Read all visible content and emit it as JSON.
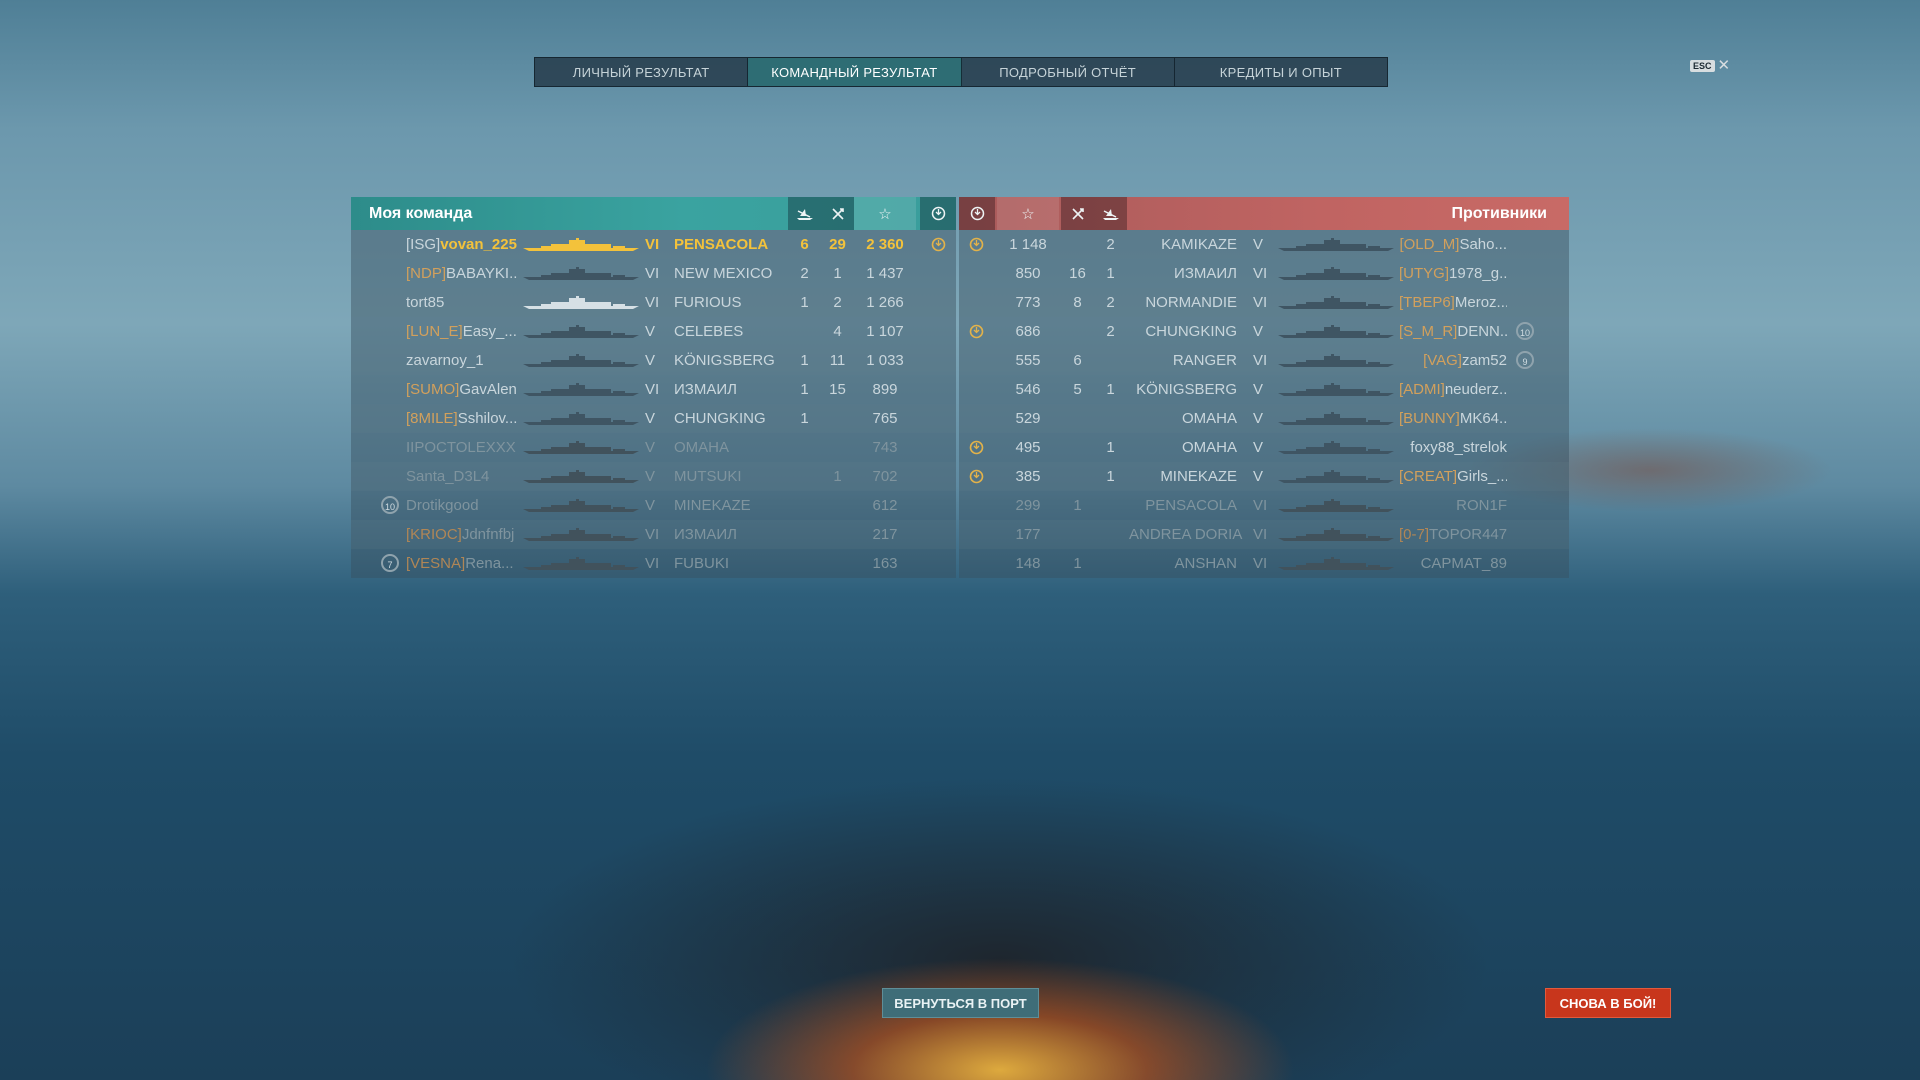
{
  "tabs": [
    "ЛИЧНЫЙ РЕЗУЛЬТАТ",
    "КОМАНДНЫЙ РЕЗУЛЬТАТ",
    "ПОДРОБНЫЙ ОТЧЁТ",
    "КРЕДИТЫ И ОПЫТ"
  ],
  "active_tab": 1,
  "esc": {
    "key": "ESC",
    "close": "✕"
  },
  "left_team": {
    "title": "Моя команда",
    "header_icons": [
      "ship-sunk-icon",
      "planes-shot-icon",
      "experience-star-icon",
      "medal-icon"
    ],
    "players": [
      {
        "clan": "[ISG]",
        "name": "vovan_225",
        "tier": "VI",
        "ship": "PENSACOLA",
        "kills": "6",
        "planes": "29",
        "xp": "2 360",
        "medal": true,
        "me": true,
        "dead": false,
        "badge": ""
      },
      {
        "clan": "[NDP]",
        "name": "BABAYKI...",
        "tier": "VI",
        "ship": "NEW MEXICO",
        "kills": "2",
        "planes": "1",
        "xp": "1 437",
        "medal": false,
        "me": false,
        "dead": false,
        "badge": ""
      },
      {
        "clan": "",
        "name": "tort85",
        "tier": "VI",
        "ship": "FURIOUS",
        "kills": "1",
        "planes": "2",
        "xp": "1 266",
        "medal": false,
        "me": false,
        "dead": false,
        "badge": ""
      },
      {
        "clan": "[LUN_E]",
        "name": "Easy_...",
        "tier": "V",
        "ship": "CELEBES",
        "kills": "",
        "planes": "4",
        "xp": "1 107",
        "medal": false,
        "me": false,
        "dead": false,
        "badge": ""
      },
      {
        "clan": "",
        "name": "zavarnoy_1",
        "tier": "V",
        "ship": "KÖNIGSBERG",
        "kills": "1",
        "planes": "11",
        "xp": "1 033",
        "medal": false,
        "me": false,
        "dead": false,
        "badge": ""
      },
      {
        "clan": "[SUMO]",
        "name": "GavAlen",
        "tier": "VI",
        "ship": "ИЗМАИЛ",
        "kills": "1",
        "planes": "15",
        "xp": "899",
        "medal": false,
        "me": false,
        "dead": false,
        "badge": ""
      },
      {
        "clan": "[8MILE]",
        "name": "Sshilov...",
        "tier": "V",
        "ship": "CHUNGKING",
        "kills": "1",
        "planes": "",
        "xp": "765",
        "medal": false,
        "me": false,
        "dead": false,
        "badge": ""
      },
      {
        "clan": "",
        "name": "IIPOCTOLEXXX",
        "tier": "V",
        "ship": "OMAHA",
        "kills": "",
        "planes": "",
        "xp": "743",
        "medal": false,
        "me": false,
        "dead": true,
        "badge": ""
      },
      {
        "clan": "",
        "name": "Santa_D3L4",
        "tier": "V",
        "ship": "MUTSUKI",
        "kills": "",
        "planes": "1",
        "xp": "702",
        "medal": false,
        "me": false,
        "dead": true,
        "badge": ""
      },
      {
        "clan": "",
        "name": "Drotikgood",
        "tier": "V",
        "ship": "MINEKAZE",
        "kills": "",
        "planes": "",
        "xp": "612",
        "medal": false,
        "me": false,
        "dead": true,
        "badge": "10"
      },
      {
        "clan": "[KRIOC]",
        "name": "Jdnfnfbj",
        "tier": "VI",
        "ship": "ИЗМАИЛ",
        "kills": "",
        "planes": "",
        "xp": "217",
        "medal": false,
        "me": false,
        "dead": true,
        "badge": ""
      },
      {
        "clan": "[VESNA]",
        "name": "Rena...",
        "tier": "VI",
        "ship": "FUBUKI",
        "kills": "",
        "planes": "",
        "xp": "163",
        "medal": false,
        "me": false,
        "dead": true,
        "badge": "7"
      }
    ]
  },
  "right_team": {
    "title": "Противники",
    "header_icons": [
      "medal-icon",
      "experience-star-icon",
      "planes-shot-icon",
      "ship-sunk-icon"
    ],
    "players": [
      {
        "medal": true,
        "xp": "1 148",
        "planes": "",
        "kills": "2",
        "ship": "KAMIKAZE",
        "tier": "V",
        "clan": "[OLD_M]",
        "name": "Saho...",
        "dead": false,
        "badge": ""
      },
      {
        "medal": false,
        "xp": "850",
        "planes": "16",
        "kills": "1",
        "ship": "ИЗМАИЛ",
        "tier": "VI",
        "clan": "[UTYG]",
        "name": "1978_g...",
        "dead": false,
        "badge": ""
      },
      {
        "medal": false,
        "xp": "773",
        "planes": "8",
        "kills": "2",
        "ship": "NORMANDIE",
        "tier": "VI",
        "clan": "[TBEP6]",
        "name": "Meroz...",
        "dead": false,
        "badge": ""
      },
      {
        "medal": true,
        "xp": "686",
        "planes": "",
        "kills": "2",
        "ship": "CHUNGKING",
        "tier": "V",
        "clan": "[S_M_R]",
        "name": "DENN...",
        "dead": false,
        "badge": "10"
      },
      {
        "medal": false,
        "xp": "555",
        "planes": "6",
        "kills": "",
        "ship": "RANGER",
        "tier": "VI",
        "clan": "[VAG]",
        "name": "zam52",
        "dead": false,
        "badge": "9"
      },
      {
        "medal": false,
        "xp": "546",
        "planes": "5",
        "kills": "1",
        "ship": "KÖNIGSBERG",
        "tier": "V",
        "clan": "[ADMI]",
        "name": "neuderz...",
        "dead": false,
        "badge": ""
      },
      {
        "medal": false,
        "xp": "529",
        "planes": "",
        "kills": "",
        "ship": "OMAHA",
        "tier": "V",
        "clan": "[BUNNY]",
        "name": "MK64...",
        "dead": false,
        "badge": ""
      },
      {
        "medal": true,
        "xp": "495",
        "planes": "",
        "kills": "1",
        "ship": "OMAHA",
        "tier": "V",
        "clan": "",
        "name": "foxy88_strelok",
        "dead": false,
        "badge": ""
      },
      {
        "medal": true,
        "xp": "385",
        "planes": "",
        "kills": "1",
        "ship": "MINEKAZE",
        "tier": "V",
        "clan": "[CREAT]",
        "name": "Girls_...",
        "dead": false,
        "badge": ""
      },
      {
        "medal": false,
        "xp": "299",
        "planes": "1",
        "kills": "",
        "ship": "PENSACOLA",
        "tier": "VI",
        "clan": "",
        "name": "RON1F",
        "dead": true,
        "badge": ""
      },
      {
        "medal": false,
        "xp": "177",
        "planes": "",
        "kills": "",
        "ship": "ANDREA DORIA",
        "tier": "VI",
        "clan": "[0-7]",
        "name": "TOPOR447",
        "dead": true,
        "badge": ""
      },
      {
        "medal": false,
        "xp": "148",
        "planes": "1",
        "kills": "",
        "ship": "ANSHAN",
        "tier": "VI",
        "clan": "",
        "name": "CAPMAT_89",
        "dead": true,
        "badge": ""
      }
    ]
  },
  "buttons": {
    "back_to_port": "ВЕРНУТЬСЯ В ПОРТ",
    "battle_again": "СНОВА В БОЙ!"
  },
  "colors": {
    "own_team": "#3aa3a0",
    "enemy_team": "#c06462",
    "highlight": "#f3c23b",
    "clan": "#d2a05c",
    "battle_button": "#c8361c"
  }
}
